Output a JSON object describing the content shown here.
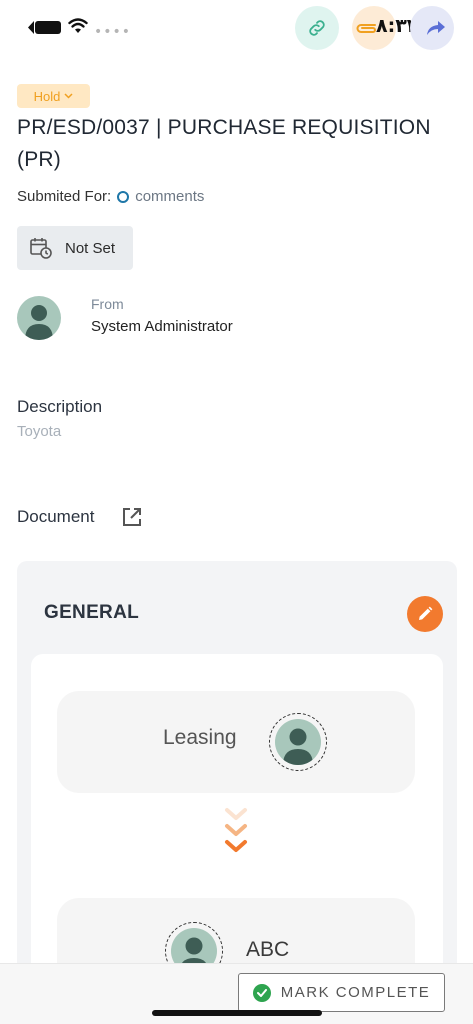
{
  "status_bar": {
    "clock": "٨:٣٣",
    "dots": "••••"
  },
  "header_actions": {
    "link_icon": "link-icon",
    "attach_icon": "paperclip-icon",
    "share_icon": "share-icon"
  },
  "request": {
    "status": "Hold",
    "title": "PR/ESD/0037 | PURCHASE REQUISITION (PR)",
    "submitted_label": "Submited For:",
    "submitted_value": "comments",
    "due_date": "Not Set"
  },
  "sender": {
    "from_label": "From",
    "name": "System Administrator"
  },
  "description": {
    "label": "Description",
    "value": "Toyota"
  },
  "document": {
    "label": "Document"
  },
  "workflow": {
    "title": "GENERAL",
    "steps": [
      {
        "name": "Leasing"
      },
      {
        "name": "ABC"
      }
    ]
  },
  "footer": {
    "mark_complete": "MARK COMPLETE"
  },
  "colors": {
    "accent_orange": "#f27a2e",
    "hold_badge_bg": "#ffe8c3",
    "hold_badge_text": "#f0a020",
    "success_green": "#2ea44f"
  }
}
